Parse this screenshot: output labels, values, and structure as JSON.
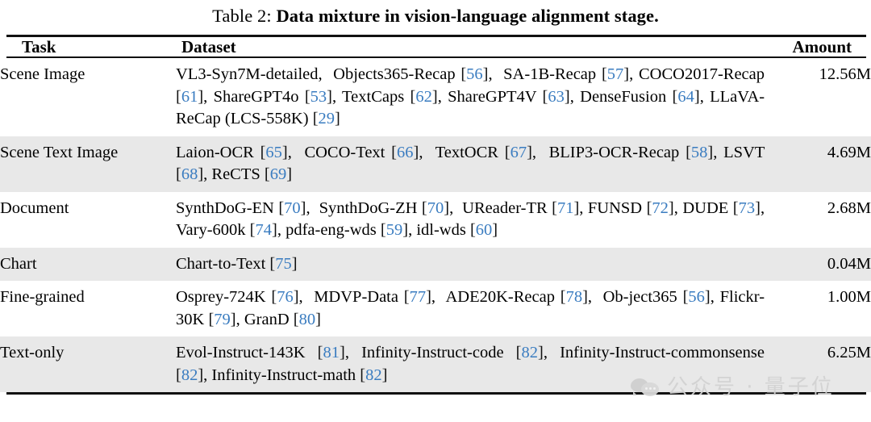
{
  "caption": {
    "label": "Table 2:",
    "text": "Data mixture in vision-language alignment stage."
  },
  "table": {
    "columns": [
      "Task",
      "Dataset",
      "Amount"
    ],
    "rows": [
      {
        "task": "Scene Image",
        "dataset": "VL3-Syn7M-detailed, Objects365-Recap [56], SA-1B-Recap [57], COCO2017-Recap [61], ShareGPT4o [53], TextCaps [62], ShareGPT4V [63], DenseFusion [64], LLaVA-ReCap (LCS-558K) [29]",
        "amount": "12.56M",
        "shaded": false
      },
      {
        "task": "Scene Text Image",
        "dataset": "Laion-OCR [65], COCO-Text [66], TextOCR [67], BLIP3-OCR-Recap [58], LSVT [68], ReCTS [69]",
        "amount": "4.69M",
        "shaded": true
      },
      {
        "task": "Document",
        "dataset": "SynthDoG-EN [70], SynthDoG-ZH [70], UReader-TR [71], FUNSD [72], DUDE [73], Vary-600k [74], pdfa-eng-wds [59], idl-wds [60]",
        "amount": "2.68M",
        "shaded": false
      },
      {
        "task": "Chart",
        "dataset": "Chart-to-Text [75]",
        "amount": "0.04M",
        "shaded": true
      },
      {
        "task": "Fine-grained",
        "dataset": "Osprey-724K [76], MDVP-Data [77], ADE20K-Recap [78], Object365 [56], Flickr-30K [79], GranD [80]",
        "amount": "1.00M",
        "shaded": false
      },
      {
        "task": "Text-only",
        "dataset": "Evol-Instruct-143K [81], Infinity-Instruct-code [82], Infinity-Instruct-commonsense [82], Infinity-Instruct-math [82]",
        "amount": "6.25M",
        "shaded": true
      }
    ]
  },
  "watermark": {
    "text": "公众号 · 量子位",
    "icon": "speech-bubbles-icon"
  },
  "colors": {
    "citation_blue": "#3a7cc0",
    "row_shade": "#e8e8e8",
    "rule": "#111111",
    "watermark_gray": "#d2d2d2"
  }
}
